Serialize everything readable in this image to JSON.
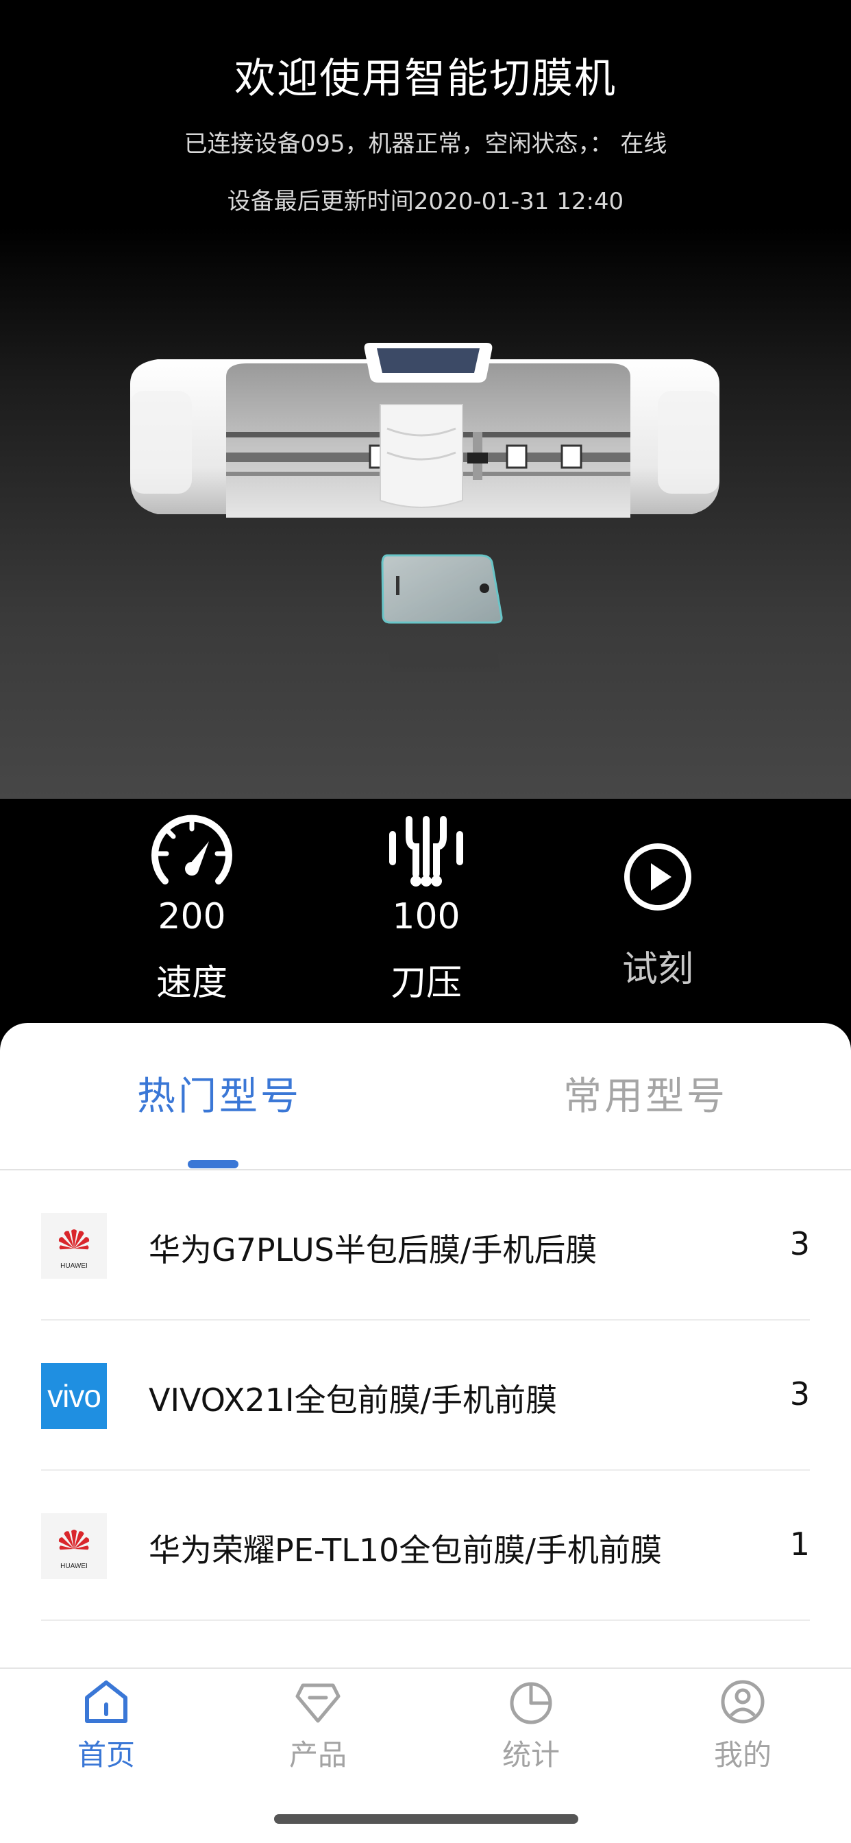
{
  "hero": {
    "title": "欢迎使用智能切膜机",
    "status_line": "已连接设备095，机器正常，空闲状态，：  在线",
    "update_line": "设备最后更新时间2020-01-31 12:40"
  },
  "stats": {
    "speed": {
      "value": "200",
      "label": "速度",
      "icon": "speedometer-icon"
    },
    "pressure": {
      "value": "100",
      "label": "刀压",
      "icon": "blade-pressure-icon"
    },
    "trial": {
      "label": "试刻",
      "icon": "play-icon"
    }
  },
  "tabs": [
    {
      "label": "热门型号",
      "active": true
    },
    {
      "label": "常用型号",
      "active": false
    }
  ],
  "list": [
    {
      "brand": "HUAWEI",
      "name": "华为G7PLUS半包后膜/手机后膜",
      "count": "3"
    },
    {
      "brand": "vivo",
      "name": "VIVOX21I全包前膜/手机前膜",
      "count": "3"
    },
    {
      "brand": "HUAWEI",
      "name": "华为荣耀PE-TL10全包前膜/手机前膜",
      "count": "1"
    }
  ],
  "nav": [
    {
      "label": "首页",
      "icon": "home-icon",
      "active": true
    },
    {
      "label": "产品",
      "icon": "diamond-icon",
      "active": false
    },
    {
      "label": "统计",
      "icon": "pie-chart-icon",
      "active": false
    },
    {
      "label": "我的",
      "icon": "user-icon",
      "active": false
    }
  ],
  "colors": {
    "accent": "#3a77d6",
    "inactive": "#a3a3a3",
    "vivo_blue": "#1f8fe1",
    "huawei_red": "#d9262b"
  }
}
